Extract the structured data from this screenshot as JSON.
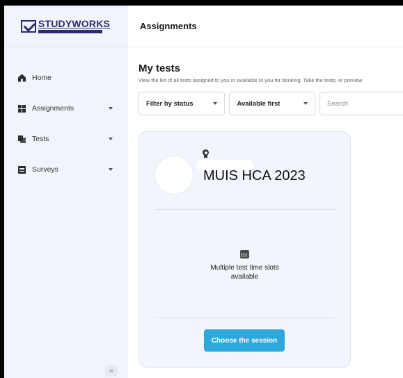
{
  "brand": {
    "name": "STUDYWORKS"
  },
  "sidebar": {
    "items": [
      {
        "label": "Home",
        "icon": "home-icon",
        "has_caret": false
      },
      {
        "label": "Assignments",
        "icon": "assignments-icon",
        "has_caret": true
      },
      {
        "label": "Tests",
        "icon": "tests-icon",
        "has_caret": true
      },
      {
        "label": "Surveys",
        "icon": "surveys-icon",
        "has_caret": true
      }
    ],
    "collapse_label": "«"
  },
  "header": {
    "title": "Assignments"
  },
  "main": {
    "heading": "My tests",
    "subtitle": "View the list of all tests assigned to you or available to you for booking. Take the tests, or preview",
    "filters": {
      "status": "Filter by status",
      "sort": "Available first",
      "search_placeholder": "Search"
    },
    "card": {
      "title": "MUIS HCA 2023",
      "slots_line1": "Multiple test time slots",
      "slots_line2": "available",
      "button": "Choose the session"
    }
  },
  "colors": {
    "accent": "#2ea8dc",
    "brand": "#2b2d6e",
    "sidebar_bg": "#f1f4fa"
  }
}
